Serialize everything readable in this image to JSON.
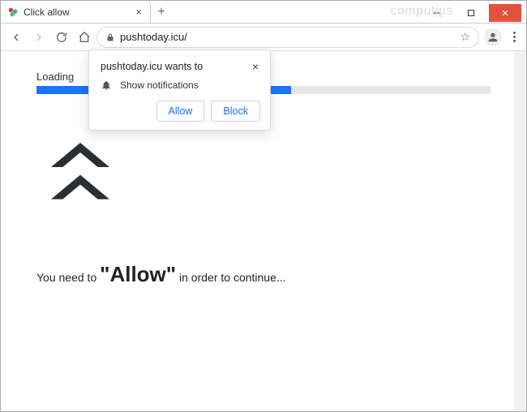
{
  "window": {
    "watermark": "computips"
  },
  "tab": {
    "title": "Click allow"
  },
  "toolbar": {
    "url": "pushtoday.icu/"
  },
  "page": {
    "loading_label": "Loading",
    "message_prefix": "You need to ",
    "message_quote_open": "\"",
    "message_big": "Allow",
    "message_quote_close": "\"",
    "message_suffix": " in order to continue..."
  },
  "popover": {
    "origin": "pushtoday.icu wants to",
    "permission": "Show notifications",
    "allow": "Allow",
    "block": "Block"
  }
}
